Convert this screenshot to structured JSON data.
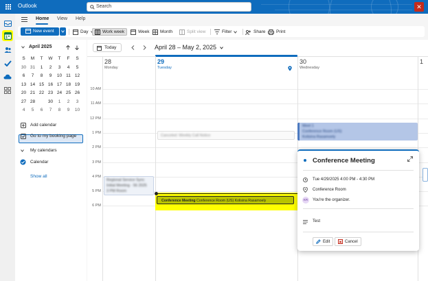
{
  "app": {
    "title": "Outlook"
  },
  "search": {
    "placeholder": "Search"
  },
  "ribbon": {
    "tabs": [
      "Home",
      "View",
      "Help"
    ],
    "new_event": "New event",
    "commands": {
      "day": "Day",
      "work_week": "Work week",
      "week": "Week",
      "month": "Month",
      "split_view": "Split view",
      "filter": "Filter",
      "share": "Share",
      "print": "Print"
    }
  },
  "mini_calendar": {
    "month_label": "April 2025",
    "weekdays": [
      "S",
      "M",
      "T",
      "W",
      "T",
      "F",
      "S"
    ],
    "weeks": [
      [
        "30",
        "31",
        "1",
        "2",
        "3",
        "4",
        "5"
      ],
      [
        "6",
        "7",
        "8",
        "9",
        "10",
        "11",
        "12"
      ],
      [
        "13",
        "14",
        "15",
        "16",
        "17",
        "18",
        "19"
      ],
      [
        "20",
        "21",
        "22",
        "23",
        "24",
        "25",
        "26"
      ],
      [
        "27",
        "28",
        "29",
        "30",
        "1",
        "2",
        "3"
      ],
      [
        "4",
        "5",
        "6",
        "7",
        "8",
        "9",
        "10"
      ]
    ],
    "today": "29"
  },
  "left_pane": {
    "add_calendar": "Add calendar",
    "booking_page": "Go to my booking page",
    "my_calendars": "My calendars",
    "calendar": "Calendar",
    "show_all": "Show all"
  },
  "main": {
    "today_btn": "Today",
    "range": "April 28 – May 2, 2025",
    "days": [
      {
        "num": "28",
        "name": "Monday"
      },
      {
        "num": "29",
        "name": "Tuesday"
      },
      {
        "num": "30",
        "name": "Wednesday"
      },
      {
        "num": "1",
        "name": ""
      }
    ],
    "hours": [
      "10 AM",
      "11 AM",
      "12 PM",
      "1 PM",
      "2 PM",
      "3 PM",
      "4 PM",
      "5 PM",
      "6 PM"
    ]
  },
  "events": {
    "highlight": {
      "title": "Conference Meeting",
      "location": "Conference Room (US)",
      "organizer": "Kolisina Rasamoely"
    },
    "blurred": {
      "tue_noon": "Canceled: Weekly Call Notice",
      "wed_noon_1": "Meet 1",
      "wed_noon_2": "Conference Room (US)",
      "wed_noon_3": "Kolisina Rasamoely",
      "mon_3pm_1": "Regional Service Sync",
      "mon_3pm_2": "Initial Meeting · 56 2025",
      "mon_3pm_3": "3 PM Room"
    }
  },
  "popup": {
    "title": "Conference Meeting",
    "time": "Tue 4/29/2025 4:00 PM - 4:30 PM",
    "location": "Conference Room",
    "avatar_initials": "KR",
    "organizer": "You're the organizer.",
    "note": "Test",
    "edit": "Edit",
    "cancel": "Cancel"
  },
  "colors": {
    "brand": "#0f6cbd",
    "highlight": "#ffff00",
    "event_olive": "#b9c300"
  }
}
